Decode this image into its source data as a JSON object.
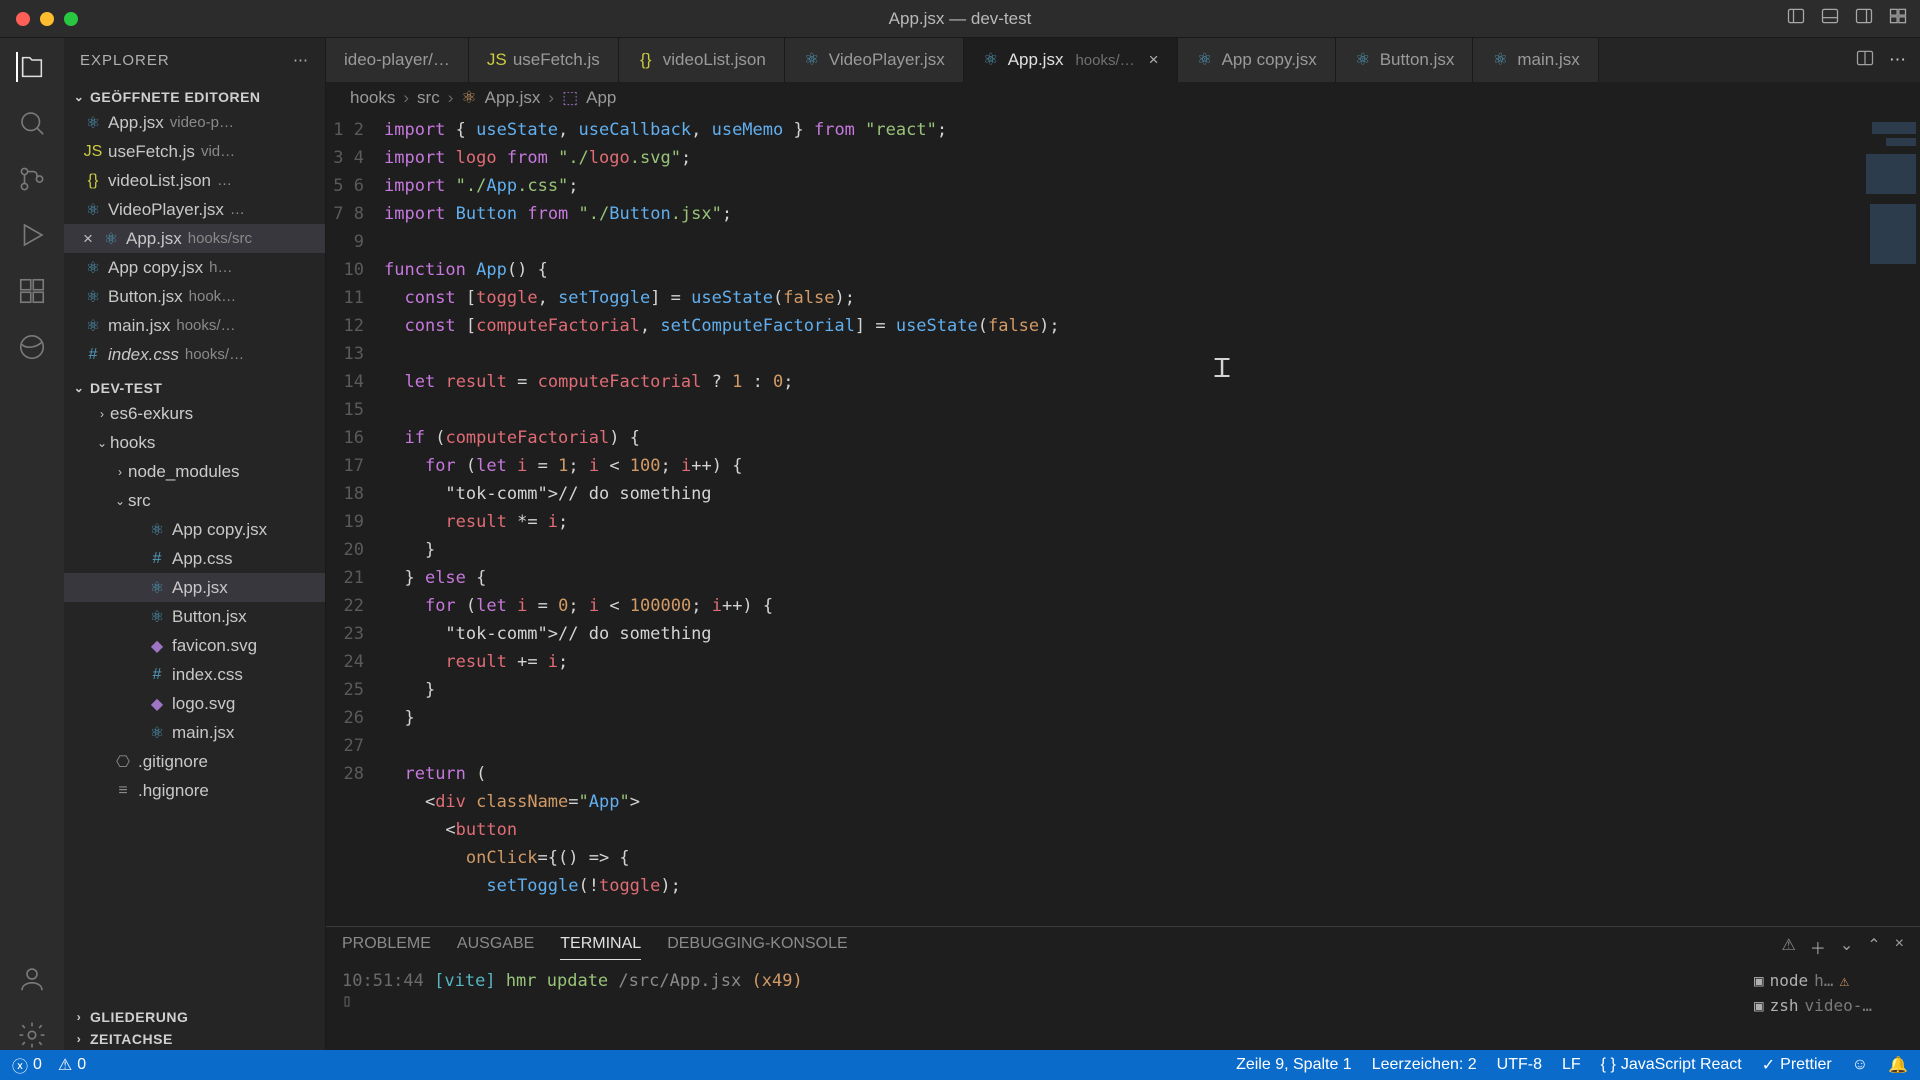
{
  "window": {
    "title": "App.jsx — dev-test"
  },
  "sidebar_title": "EXPLORER",
  "sections": {
    "open_editors": "GEÖFFNETE EDITOREN",
    "project": "DEV-TEST",
    "outline": "GLIEDERUNG",
    "timeline": "ZEITACHSE"
  },
  "open_editors": [
    {
      "name": "App.jsx",
      "hint": "video-p…"
    },
    {
      "name": "useFetch.js",
      "hint": "vid…"
    },
    {
      "name": "videoList.json",
      "hint": "…"
    },
    {
      "name": "VideoPlayer.jsx",
      "hint": "…"
    },
    {
      "name": "App.jsx",
      "hint": "hooks/src"
    },
    {
      "name": "App copy.jsx",
      "hint": "h…"
    },
    {
      "name": "Button.jsx",
      "hint": "hook…"
    },
    {
      "name": "main.jsx",
      "hint": "hooks/…"
    },
    {
      "name": "index.css",
      "hint": "hooks/…"
    }
  ],
  "tree": {
    "folders": {
      "es6": "es6-exkurs",
      "hooks": "hooks",
      "node_modules": "node_modules",
      "src": "src"
    },
    "src_files": [
      "App copy.jsx",
      "App.css",
      "App.jsx",
      "Button.jsx",
      "favicon.svg",
      "index.css",
      "logo.svg",
      "main.jsx"
    ],
    "root_files": [
      ".gitignore",
      ".hgignore"
    ]
  },
  "tabs": [
    {
      "label": "ideo-player/…",
      "short": true
    },
    {
      "label": "useFetch.js"
    },
    {
      "label": "videoList.json"
    },
    {
      "label": "VideoPlayer.jsx"
    },
    {
      "label": "App.jsx",
      "hint": "hooks/…",
      "active": true
    },
    {
      "label": "App copy.jsx"
    },
    {
      "label": "Button.jsx"
    },
    {
      "label": "main.jsx"
    }
  ],
  "breadcrumb": [
    "hooks",
    "src",
    "App.jsx",
    "App"
  ],
  "code_lines": [
    "import { useState, useCallback, useMemo } from \"react\";",
    "import logo from \"./logo.svg\";",
    "import \"./App.css\";",
    "import Button from \"./Button.jsx\";",
    "",
    "function App() {",
    "  const [toggle, setToggle] = useState(false);",
    "  const [computeFactorial, setComputeFactorial] = useState(false);",
    "",
    "  let result = computeFactorial ? 1 : 0;",
    "",
    "  if (computeFactorial) {",
    "    for (let i = 1; i < 100; i++) {",
    "      // do something",
    "      result *= i;",
    "    }",
    "  } else {",
    "    for (let i = 0; i < 100000; i++) {",
    "      // do something",
    "      result += i;",
    "    }",
    "  }",
    "",
    "  return (",
    "    <div className=\"App\">",
    "      <button",
    "        onClick={() => {",
    "          setToggle(!toggle);"
  ],
  "panel": {
    "tabs": [
      "PROBLEME",
      "AUSGABE",
      "TERMINAL",
      "DEBUGGING-KONSOLE"
    ],
    "active_tab": "TERMINAL",
    "log_time": "10:51:44",
    "log_vite": "[vite]",
    "log_hmr": "hmr update",
    "log_path": "/src/App.jsx",
    "log_count": "(x49)",
    "side": [
      {
        "shell": "node",
        "tag": "h…",
        "warn": true
      },
      {
        "shell": "zsh",
        "tag": "video-…"
      }
    ]
  },
  "statusbar": {
    "errors": "0",
    "warnings": "0",
    "cursor": "Zeile 9, Spalte 1",
    "spaces": "Leerzeichen: 2",
    "encoding": "UTF-8",
    "eol": "LF",
    "lang": "JavaScript React",
    "prettier": "Prettier"
  }
}
